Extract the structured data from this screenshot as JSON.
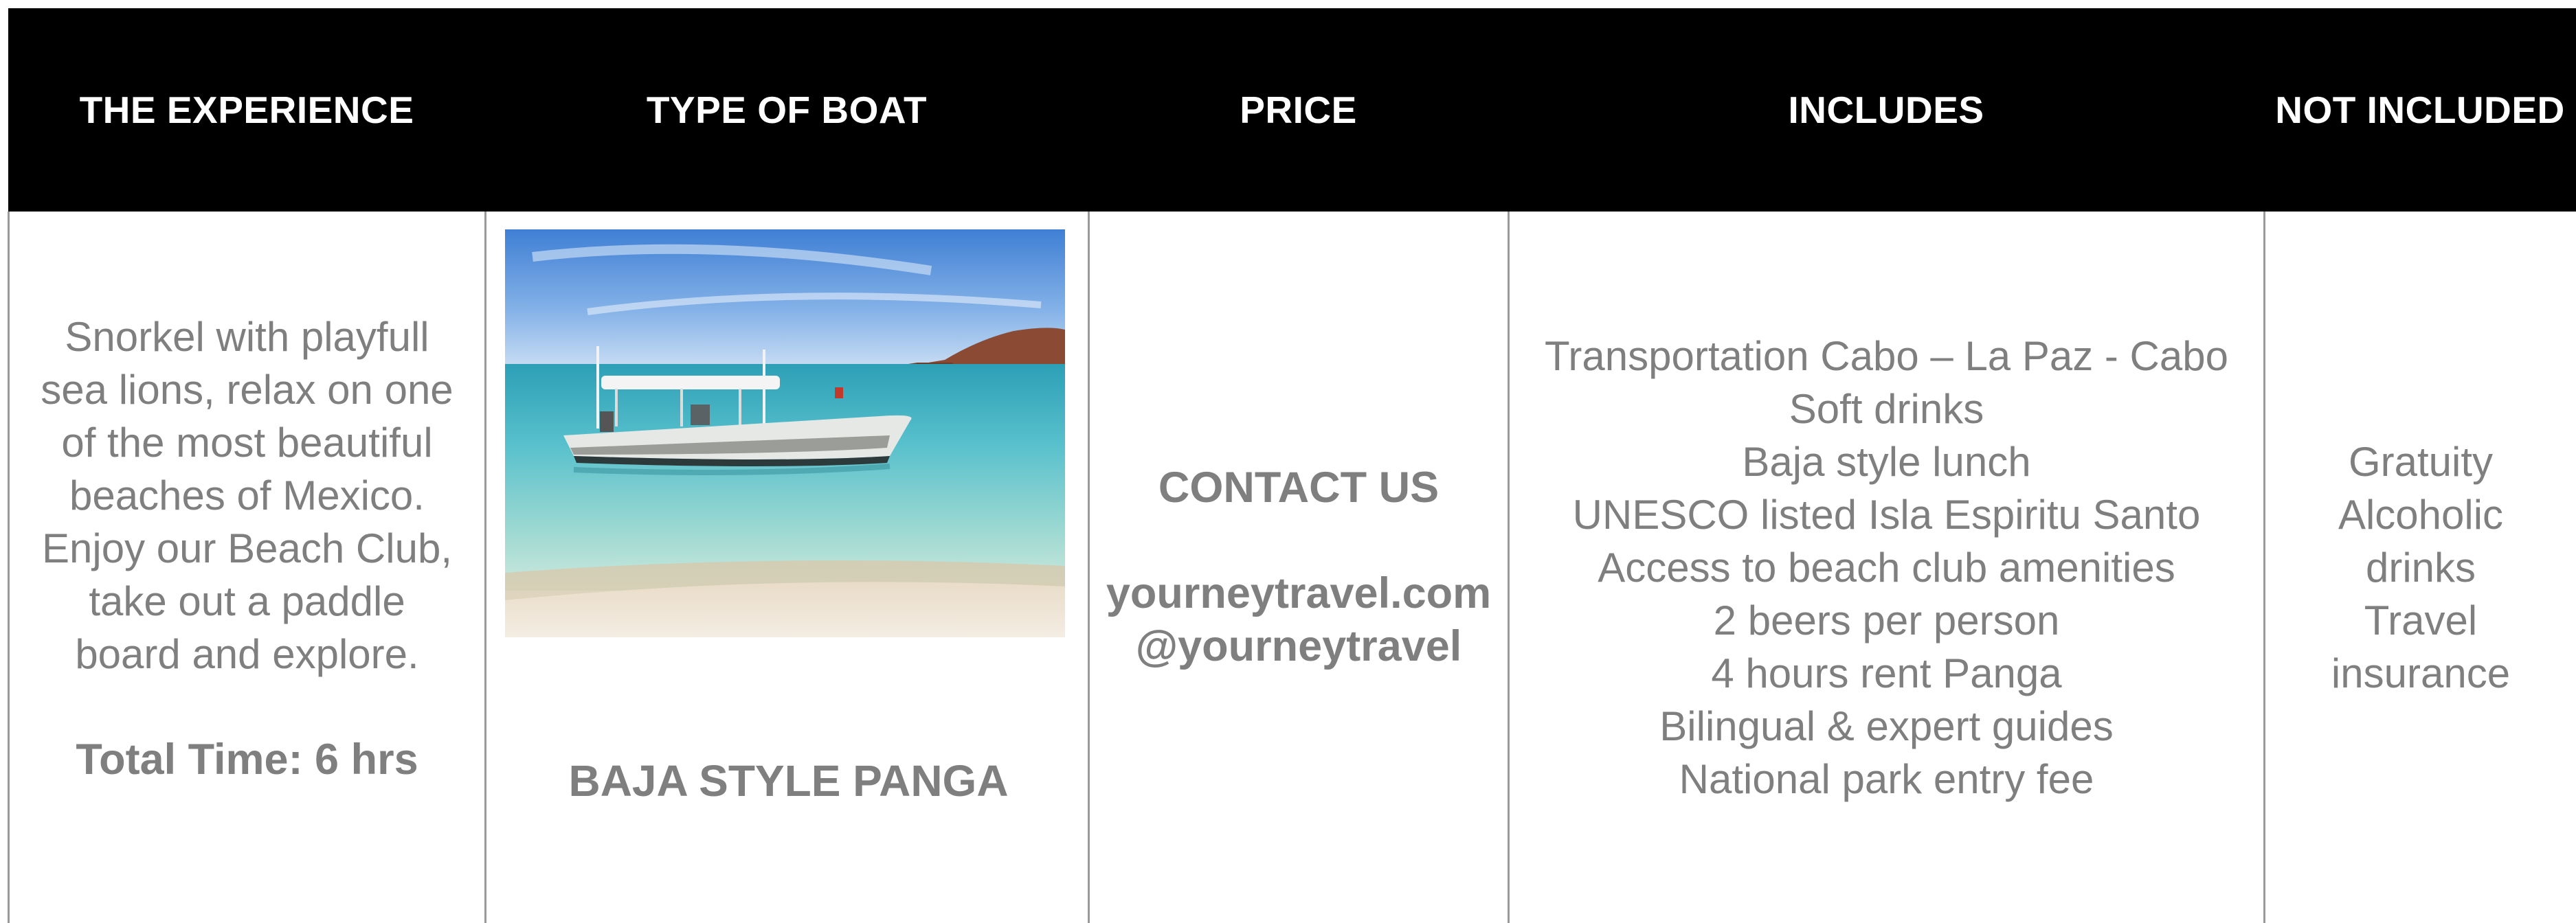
{
  "headers": {
    "experience": "THE EXPERIENCE",
    "boat": "TYPE OF BOAT",
    "price": "PRICE",
    "includes": "INCLUDES",
    "not_included": "NOT INCLUDED"
  },
  "experience": {
    "lines": [
      "Snorkel with playfull",
      "sea lions, relax on one",
      "of the most beautiful",
      "beaches of Mexico.",
      "Enjoy our Beach Club,",
      "take out a paddle",
      "board and explore."
    ],
    "total_time": "Total Time: 6 hrs"
  },
  "boat": {
    "name": "BAJA STYLE PANGA"
  },
  "price": {
    "contact": "CONTACT US",
    "website": "yourneytravel.com",
    "handle": "@yourneytravel"
  },
  "includes": [
    "Transportation Cabo – La Paz - Cabo",
    "Soft drinks",
    "Baja style lunch",
    "UNESCO listed Isla Espiritu Santo",
    "Access to beach club amenities",
    "2 beers per person",
    "4 hours rent Panga",
    "Bilingual & expert guides",
    "National park entry fee"
  ],
  "not_included": [
    "Gratuity",
    "Alcoholic",
    "drinks",
    "Travel",
    "insurance"
  ],
  "colors": {
    "header_bg": "#000000",
    "header_text": "#ffffff",
    "body_text": "#7f7f7f",
    "divider": "#9a9a9a"
  }
}
